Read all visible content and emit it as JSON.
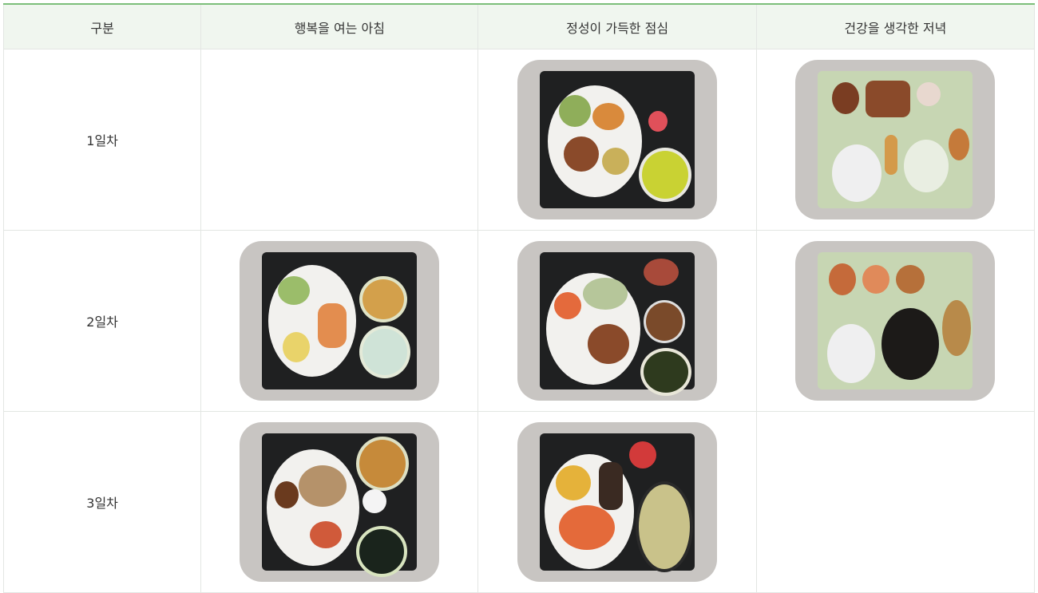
{
  "table": {
    "headers": [
      "구분",
      "행복을 여는 아침",
      "정성이 가득한 점심",
      "건강을 생각한 저녁"
    ],
    "rows": [
      {
        "label": "1일차",
        "meals": [
          null,
          "lunch-tray-photo",
          "dinner-tray-photo"
        ]
      },
      {
        "label": "2일차",
        "meals": [
          "breakfast-tray-photo",
          "lunch-tray-photo",
          "dinner-tray-photo"
        ]
      },
      {
        "label": "3일차",
        "meals": [
          "breakfast-tray-photo",
          "lunch-tray-photo",
          null
        ]
      }
    ]
  }
}
